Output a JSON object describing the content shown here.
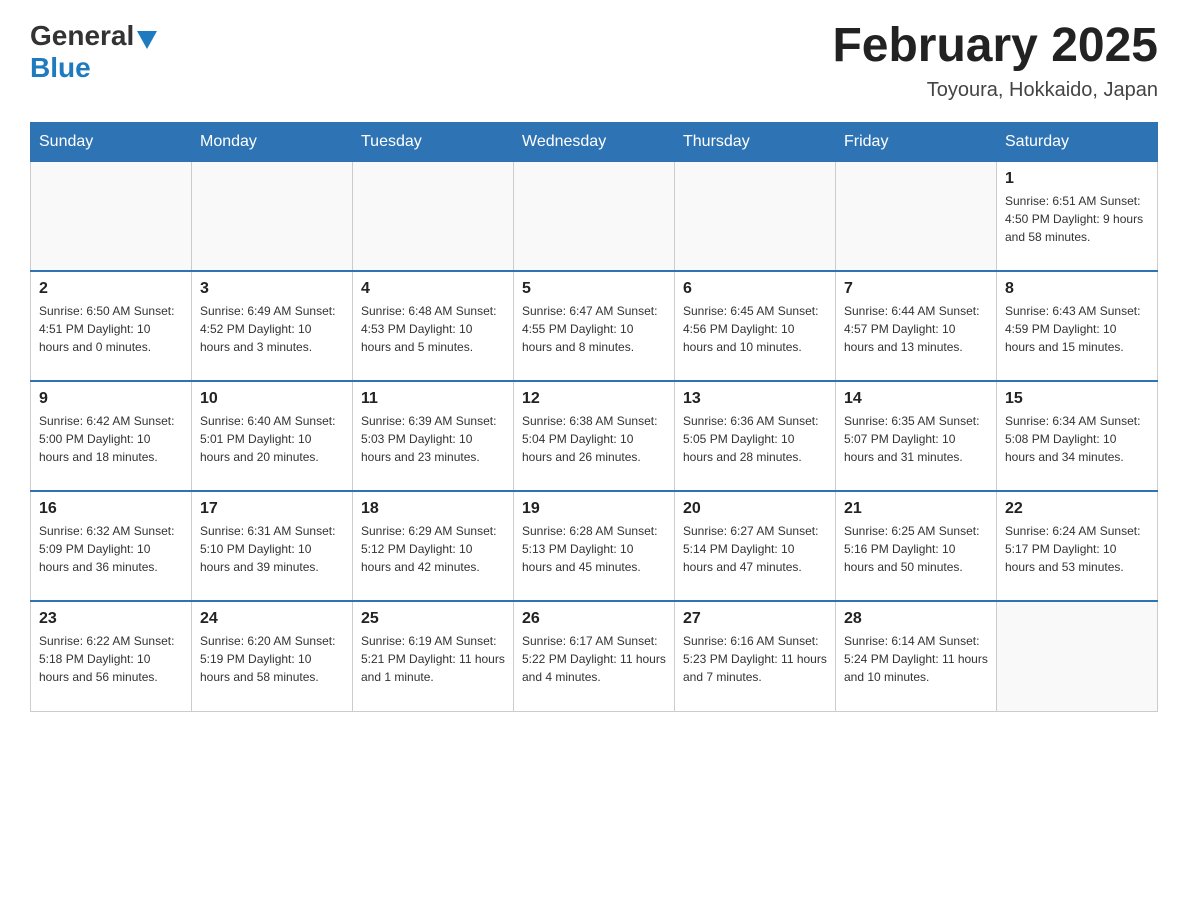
{
  "header": {
    "logo_general": "General",
    "logo_blue": "Blue",
    "title": "February 2025",
    "subtitle": "Toyoura, Hokkaido, Japan"
  },
  "days_of_week": [
    "Sunday",
    "Monday",
    "Tuesday",
    "Wednesday",
    "Thursday",
    "Friday",
    "Saturday"
  ],
  "weeks": [
    [
      {
        "day": "",
        "info": ""
      },
      {
        "day": "",
        "info": ""
      },
      {
        "day": "",
        "info": ""
      },
      {
        "day": "",
        "info": ""
      },
      {
        "day": "",
        "info": ""
      },
      {
        "day": "",
        "info": ""
      },
      {
        "day": "1",
        "info": "Sunrise: 6:51 AM\nSunset: 4:50 PM\nDaylight: 9 hours\nand 58 minutes."
      }
    ],
    [
      {
        "day": "2",
        "info": "Sunrise: 6:50 AM\nSunset: 4:51 PM\nDaylight: 10 hours\nand 0 minutes."
      },
      {
        "day": "3",
        "info": "Sunrise: 6:49 AM\nSunset: 4:52 PM\nDaylight: 10 hours\nand 3 minutes."
      },
      {
        "day": "4",
        "info": "Sunrise: 6:48 AM\nSunset: 4:53 PM\nDaylight: 10 hours\nand 5 minutes."
      },
      {
        "day": "5",
        "info": "Sunrise: 6:47 AM\nSunset: 4:55 PM\nDaylight: 10 hours\nand 8 minutes."
      },
      {
        "day": "6",
        "info": "Sunrise: 6:45 AM\nSunset: 4:56 PM\nDaylight: 10 hours\nand 10 minutes."
      },
      {
        "day": "7",
        "info": "Sunrise: 6:44 AM\nSunset: 4:57 PM\nDaylight: 10 hours\nand 13 minutes."
      },
      {
        "day": "8",
        "info": "Sunrise: 6:43 AM\nSunset: 4:59 PM\nDaylight: 10 hours\nand 15 minutes."
      }
    ],
    [
      {
        "day": "9",
        "info": "Sunrise: 6:42 AM\nSunset: 5:00 PM\nDaylight: 10 hours\nand 18 minutes."
      },
      {
        "day": "10",
        "info": "Sunrise: 6:40 AM\nSunset: 5:01 PM\nDaylight: 10 hours\nand 20 minutes."
      },
      {
        "day": "11",
        "info": "Sunrise: 6:39 AM\nSunset: 5:03 PM\nDaylight: 10 hours\nand 23 minutes."
      },
      {
        "day": "12",
        "info": "Sunrise: 6:38 AM\nSunset: 5:04 PM\nDaylight: 10 hours\nand 26 minutes."
      },
      {
        "day": "13",
        "info": "Sunrise: 6:36 AM\nSunset: 5:05 PM\nDaylight: 10 hours\nand 28 minutes."
      },
      {
        "day": "14",
        "info": "Sunrise: 6:35 AM\nSunset: 5:07 PM\nDaylight: 10 hours\nand 31 minutes."
      },
      {
        "day": "15",
        "info": "Sunrise: 6:34 AM\nSunset: 5:08 PM\nDaylight: 10 hours\nand 34 minutes."
      }
    ],
    [
      {
        "day": "16",
        "info": "Sunrise: 6:32 AM\nSunset: 5:09 PM\nDaylight: 10 hours\nand 36 minutes."
      },
      {
        "day": "17",
        "info": "Sunrise: 6:31 AM\nSunset: 5:10 PM\nDaylight: 10 hours\nand 39 minutes."
      },
      {
        "day": "18",
        "info": "Sunrise: 6:29 AM\nSunset: 5:12 PM\nDaylight: 10 hours\nand 42 minutes."
      },
      {
        "day": "19",
        "info": "Sunrise: 6:28 AM\nSunset: 5:13 PM\nDaylight: 10 hours\nand 45 minutes."
      },
      {
        "day": "20",
        "info": "Sunrise: 6:27 AM\nSunset: 5:14 PM\nDaylight: 10 hours\nand 47 minutes."
      },
      {
        "day": "21",
        "info": "Sunrise: 6:25 AM\nSunset: 5:16 PM\nDaylight: 10 hours\nand 50 minutes."
      },
      {
        "day": "22",
        "info": "Sunrise: 6:24 AM\nSunset: 5:17 PM\nDaylight: 10 hours\nand 53 minutes."
      }
    ],
    [
      {
        "day": "23",
        "info": "Sunrise: 6:22 AM\nSunset: 5:18 PM\nDaylight: 10 hours\nand 56 minutes."
      },
      {
        "day": "24",
        "info": "Sunrise: 6:20 AM\nSunset: 5:19 PM\nDaylight: 10 hours\nand 58 minutes."
      },
      {
        "day": "25",
        "info": "Sunrise: 6:19 AM\nSunset: 5:21 PM\nDaylight: 11 hours\nand 1 minute."
      },
      {
        "day": "26",
        "info": "Sunrise: 6:17 AM\nSunset: 5:22 PM\nDaylight: 11 hours\nand 4 minutes."
      },
      {
        "day": "27",
        "info": "Sunrise: 6:16 AM\nSunset: 5:23 PM\nDaylight: 11 hours\nand 7 minutes."
      },
      {
        "day": "28",
        "info": "Sunrise: 6:14 AM\nSunset: 5:24 PM\nDaylight: 11 hours\nand 10 minutes."
      },
      {
        "day": "",
        "info": ""
      }
    ]
  ],
  "colors": {
    "header_bg": "#2e74b5",
    "header_text": "#ffffff",
    "border": "#cccccc",
    "title_color": "#222222"
  }
}
